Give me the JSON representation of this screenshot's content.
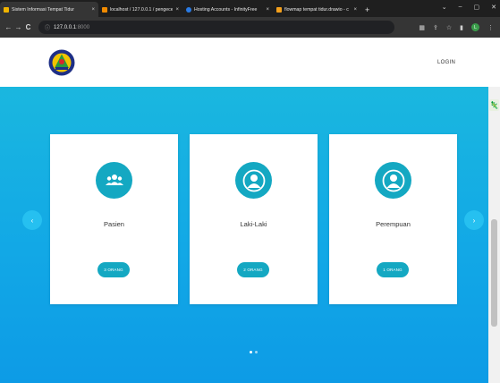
{
  "browser": {
    "tabs": [
      {
        "title": "Sistem Informasi Tempat Tidur",
        "favicon_color": "#f0b400",
        "active": true
      },
      {
        "title": "localhost / 127.0.0.1 / pengecekt",
        "favicon_color": "#f08a00",
        "active": false
      },
      {
        "title": "Hosting Accounts - InfinityFree",
        "favicon_color": "#2a7be4",
        "active": false
      },
      {
        "title": "flowmap tempat tidur.drawio - c",
        "favicon_color": "#f4a01c",
        "active": false
      }
    ],
    "tab_close_glyph": "×",
    "new_tab_glyph": "+",
    "window_controls": [
      "⌄",
      "–",
      "▢",
      "✕"
    ],
    "nav_glyphs": {
      "back": "←",
      "forward": "→",
      "reload": "C"
    },
    "url": "127.0.0.1",
    "url_port": ":8000",
    "info_glyph": "ⓘ",
    "toolbar_glyphs": [
      "▦",
      "⇪",
      "☆",
      "▮"
    ],
    "profile_initial": "L",
    "menu_glyph": "⋮",
    "extension_glyph": "🦎"
  },
  "header": {
    "logo": "hospital-logo",
    "login_label": "LOGIN"
  },
  "carousel": {
    "prev_glyph": "‹",
    "next_glyph": "›",
    "cards": [
      {
        "label": "Pasien",
        "count": "3 ORANG",
        "icon": "users-icon"
      },
      {
        "label": "Laki-Laki",
        "count": "2 ORANG",
        "icon": "user-icon"
      },
      {
        "label": "Perempuan",
        "count": "1 ORANG",
        "icon": "user-icon"
      }
    ],
    "dots": 2,
    "active_dot": 0
  },
  "colors": {
    "accent": "#14a8c2",
    "hero_top": "#1ab7df",
    "hero_bottom": "#0d9be6",
    "arrow": "#26c0f0"
  }
}
